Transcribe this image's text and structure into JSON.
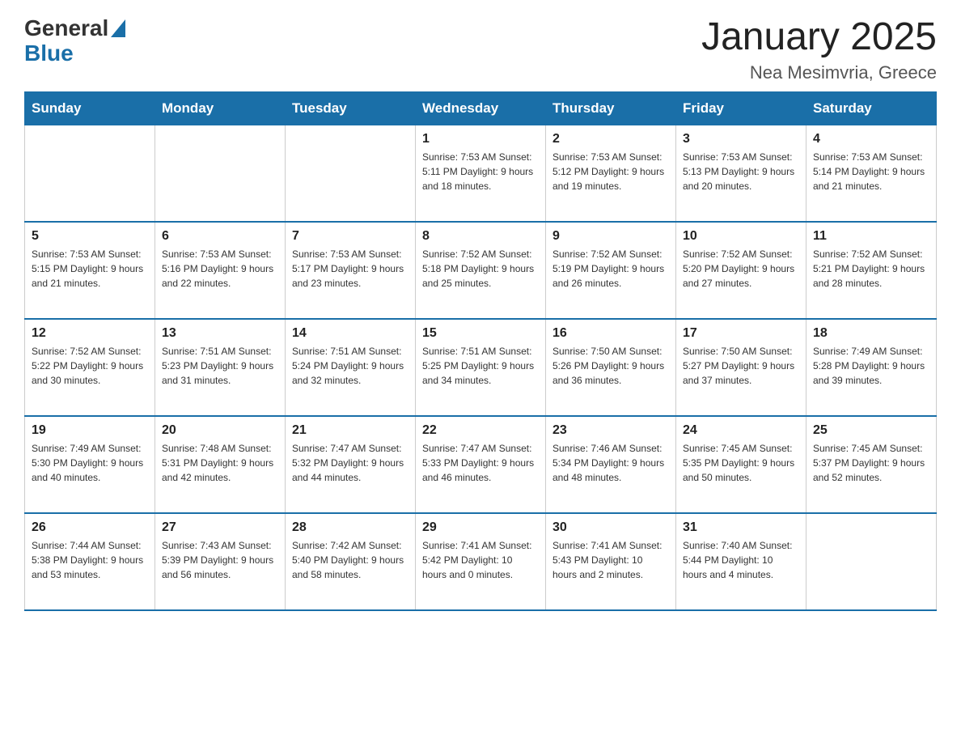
{
  "header": {
    "logo_general": "General",
    "logo_blue": "Blue",
    "title": "January 2025",
    "subtitle": "Nea Mesimvria, Greece"
  },
  "days_of_week": [
    "Sunday",
    "Monday",
    "Tuesday",
    "Wednesday",
    "Thursday",
    "Friday",
    "Saturday"
  ],
  "weeks": [
    [
      {
        "day": "",
        "info": ""
      },
      {
        "day": "",
        "info": ""
      },
      {
        "day": "",
        "info": ""
      },
      {
        "day": "1",
        "info": "Sunrise: 7:53 AM\nSunset: 5:11 PM\nDaylight: 9 hours\nand 18 minutes."
      },
      {
        "day": "2",
        "info": "Sunrise: 7:53 AM\nSunset: 5:12 PM\nDaylight: 9 hours\nand 19 minutes."
      },
      {
        "day": "3",
        "info": "Sunrise: 7:53 AM\nSunset: 5:13 PM\nDaylight: 9 hours\nand 20 minutes."
      },
      {
        "day": "4",
        "info": "Sunrise: 7:53 AM\nSunset: 5:14 PM\nDaylight: 9 hours\nand 21 minutes."
      }
    ],
    [
      {
        "day": "5",
        "info": "Sunrise: 7:53 AM\nSunset: 5:15 PM\nDaylight: 9 hours\nand 21 minutes."
      },
      {
        "day": "6",
        "info": "Sunrise: 7:53 AM\nSunset: 5:16 PM\nDaylight: 9 hours\nand 22 minutes."
      },
      {
        "day": "7",
        "info": "Sunrise: 7:53 AM\nSunset: 5:17 PM\nDaylight: 9 hours\nand 23 minutes."
      },
      {
        "day": "8",
        "info": "Sunrise: 7:52 AM\nSunset: 5:18 PM\nDaylight: 9 hours\nand 25 minutes."
      },
      {
        "day": "9",
        "info": "Sunrise: 7:52 AM\nSunset: 5:19 PM\nDaylight: 9 hours\nand 26 minutes."
      },
      {
        "day": "10",
        "info": "Sunrise: 7:52 AM\nSunset: 5:20 PM\nDaylight: 9 hours\nand 27 minutes."
      },
      {
        "day": "11",
        "info": "Sunrise: 7:52 AM\nSunset: 5:21 PM\nDaylight: 9 hours\nand 28 minutes."
      }
    ],
    [
      {
        "day": "12",
        "info": "Sunrise: 7:52 AM\nSunset: 5:22 PM\nDaylight: 9 hours\nand 30 minutes."
      },
      {
        "day": "13",
        "info": "Sunrise: 7:51 AM\nSunset: 5:23 PM\nDaylight: 9 hours\nand 31 minutes."
      },
      {
        "day": "14",
        "info": "Sunrise: 7:51 AM\nSunset: 5:24 PM\nDaylight: 9 hours\nand 32 minutes."
      },
      {
        "day": "15",
        "info": "Sunrise: 7:51 AM\nSunset: 5:25 PM\nDaylight: 9 hours\nand 34 minutes."
      },
      {
        "day": "16",
        "info": "Sunrise: 7:50 AM\nSunset: 5:26 PM\nDaylight: 9 hours\nand 36 minutes."
      },
      {
        "day": "17",
        "info": "Sunrise: 7:50 AM\nSunset: 5:27 PM\nDaylight: 9 hours\nand 37 minutes."
      },
      {
        "day": "18",
        "info": "Sunrise: 7:49 AM\nSunset: 5:28 PM\nDaylight: 9 hours\nand 39 minutes."
      }
    ],
    [
      {
        "day": "19",
        "info": "Sunrise: 7:49 AM\nSunset: 5:30 PM\nDaylight: 9 hours\nand 40 minutes."
      },
      {
        "day": "20",
        "info": "Sunrise: 7:48 AM\nSunset: 5:31 PM\nDaylight: 9 hours\nand 42 minutes."
      },
      {
        "day": "21",
        "info": "Sunrise: 7:47 AM\nSunset: 5:32 PM\nDaylight: 9 hours\nand 44 minutes."
      },
      {
        "day": "22",
        "info": "Sunrise: 7:47 AM\nSunset: 5:33 PM\nDaylight: 9 hours\nand 46 minutes."
      },
      {
        "day": "23",
        "info": "Sunrise: 7:46 AM\nSunset: 5:34 PM\nDaylight: 9 hours\nand 48 minutes."
      },
      {
        "day": "24",
        "info": "Sunrise: 7:45 AM\nSunset: 5:35 PM\nDaylight: 9 hours\nand 50 minutes."
      },
      {
        "day": "25",
        "info": "Sunrise: 7:45 AM\nSunset: 5:37 PM\nDaylight: 9 hours\nand 52 minutes."
      }
    ],
    [
      {
        "day": "26",
        "info": "Sunrise: 7:44 AM\nSunset: 5:38 PM\nDaylight: 9 hours\nand 53 minutes."
      },
      {
        "day": "27",
        "info": "Sunrise: 7:43 AM\nSunset: 5:39 PM\nDaylight: 9 hours\nand 56 minutes."
      },
      {
        "day": "28",
        "info": "Sunrise: 7:42 AM\nSunset: 5:40 PM\nDaylight: 9 hours\nand 58 minutes."
      },
      {
        "day": "29",
        "info": "Sunrise: 7:41 AM\nSunset: 5:42 PM\nDaylight: 10 hours\nand 0 minutes."
      },
      {
        "day": "30",
        "info": "Sunrise: 7:41 AM\nSunset: 5:43 PM\nDaylight: 10 hours\nand 2 minutes."
      },
      {
        "day": "31",
        "info": "Sunrise: 7:40 AM\nSunset: 5:44 PM\nDaylight: 10 hours\nand 4 minutes."
      },
      {
        "day": "",
        "info": ""
      }
    ]
  ]
}
